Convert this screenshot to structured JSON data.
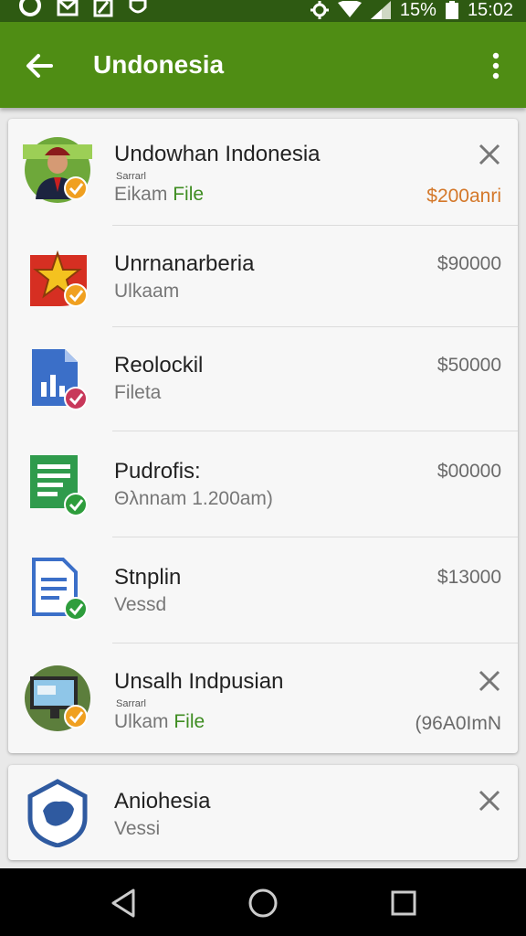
{
  "status_bar": {
    "battery": "15%",
    "time": "15:02",
    "icons": [
      "sync-icon",
      "gmail-icon",
      "edit-icon",
      "shield-icon",
      "settings-icon",
      "wifi-icon",
      "signal-icon",
      "battery-icon"
    ]
  },
  "app_bar": {
    "title": "Undonesia",
    "back_icon": "arrow-back-icon",
    "more_icon": "more-vert-icon"
  },
  "items": [
    {
      "title": "Undowhan Indonesia",
      "tiny": "Sarrarl",
      "sub_plain": "Eikam",
      "sub_accent": "File",
      "amount": "$200anri",
      "amount_color": "#d4782a",
      "has_close": true,
      "avatar": "person-photo",
      "badge_color": "#f0a020"
    },
    {
      "title": "Unrnanarberia",
      "tiny": "",
      "sub_plain": "Ulkaam",
      "sub_accent": "",
      "amount": "$90000",
      "has_close": false,
      "avatar": "emblem-icon",
      "badge_color": "#f0a020"
    },
    {
      "title": "Reolockil",
      "tiny": "",
      "sub_plain": "Fileta",
      "sub_accent": "",
      "amount": "$50000",
      "has_close": false,
      "avatar": "chart-doc-icon",
      "badge_color": "#c8385a"
    },
    {
      "title": "Pudrofis:",
      "tiny": "",
      "sub_plain": "Θλnnam 1.200am)",
      "sub_accent": "",
      "amount": "$00000",
      "has_close": false,
      "avatar": "sheet-doc-icon",
      "badge_color": "#2e9d3c"
    },
    {
      "title": "Stnplin",
      "tiny": "",
      "sub_plain": "Vessd",
      "sub_accent": "",
      "amount": "$13000",
      "has_close": false,
      "avatar": "text-doc-icon",
      "badge_color": "#2e9d3c"
    },
    {
      "title": "Unsalh Indpusian",
      "tiny": "Sarrarl",
      "sub_plain": "Ulkam",
      "sub_accent": "File",
      "amount": "(96A0ImN",
      "has_close": true,
      "avatar": "monitor-photo",
      "badge_color": "#f0a020"
    }
  ],
  "card_two": {
    "title": "Aniohesia",
    "sub": "Vessi",
    "avatar": "shield-map-icon"
  },
  "nav_bar": {
    "icons": [
      "back-triangle-icon",
      "home-circle-icon",
      "recents-square-icon"
    ]
  },
  "colors": {
    "app_bar": "#4f8d14",
    "status_bar": "#2e5a12",
    "accent_green": "#3f8d22",
    "accent_orange": "#d4782a"
  }
}
